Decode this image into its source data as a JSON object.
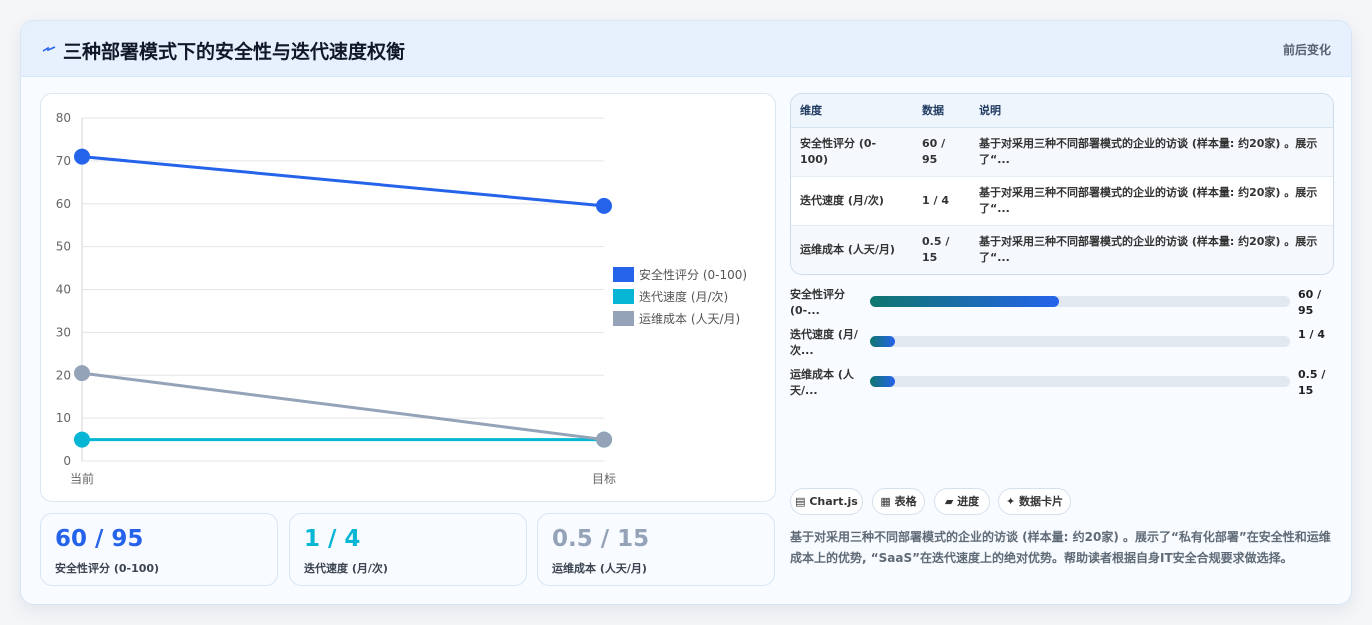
{
  "header": {
    "title": "三种部署模式下的安全性与迭代速度权衡",
    "right_label": "前后变化",
    "icon": "lightning-icon"
  },
  "chart_data": {
    "type": "line",
    "categories": [
      "当前",
      "目标"
    ],
    "series": [
      {
        "name": "安全性评分 (0-100)",
        "values": [
          71,
          59.5
        ],
        "color": "#2563eb"
      },
      {
        "name": "迭代速度 (月/次)",
        "values": [
          5,
          5
        ],
        "color": "#06b6d4"
      },
      {
        "name": "运维成本 (人天/月)",
        "values": [
          20.5,
          5
        ],
        "color": "#94a3b8"
      }
    ],
    "ylim": [
      0,
      80
    ],
    "yticks": [
      0,
      10,
      20,
      30,
      40,
      50,
      60,
      70,
      80
    ],
    "legend_position": "right",
    "grid": true
  },
  "stats": [
    {
      "value": "60 / 95",
      "label": "安全性评分 (0-100)",
      "color": "#2563eb"
    },
    {
      "value": "1 / 4",
      "label": "迭代速度 (月/次)",
      "color": "#06b6d4"
    },
    {
      "value": "0.5 / 15",
      "label": "运维成本 (人天/月)",
      "color": "#94a3b8"
    }
  ],
  "table": {
    "headers": [
      "维度",
      "数据",
      "说明"
    ],
    "rows": [
      {
        "dim": "安全性评分 (0-100)",
        "data": "60 / 95",
        "desc": "基于对采用三种不同部署模式的企业的访谈 (样本量: 约20家) 。展示了“..."
      },
      {
        "dim": "迭代速度 (月/次)",
        "data": "1 / 4",
        "desc": "基于对采用三种不同部署模式的企业的访谈 (样本量: 约20家) 。展示了“..."
      },
      {
        "dim": "运维成本 (人天/月)",
        "data": "0.5 / 15",
        "desc": "基于对采用三种不同部署模式的企业的访谈 (样本量: 约20家) 。展示了“..."
      }
    ]
  },
  "progress": [
    {
      "label": "安全性评分 (0-...",
      "value": "60 / 95",
      "fraction": 0.45
    },
    {
      "label": "迭代速度 (月/次...",
      "value": "1 / 4",
      "fraction": 0.06
    },
    {
      "label": "运维成本 (人天/...",
      "value": "0.5 / 15",
      "fraction": 0.06
    }
  ],
  "chips": [
    {
      "label": "▤ Chart.js",
      "icon": "chart-icon"
    },
    {
      "label": "▦ 表格",
      "icon": "table-icon"
    },
    {
      "label": "▰ 进度",
      "icon": "progress-icon"
    },
    {
      "label": "✦ 数据卡片",
      "icon": "card-icon"
    }
  ],
  "description": "基于对采用三种不同部署模式的企业的访谈 (样本量: 约20家) 。展示了“私有化部署”在安全性和运维成本上的优势, “SaaS”在迭代速度上的绝对优势。帮助读者根据自身IT安全合规要求做选择。"
}
